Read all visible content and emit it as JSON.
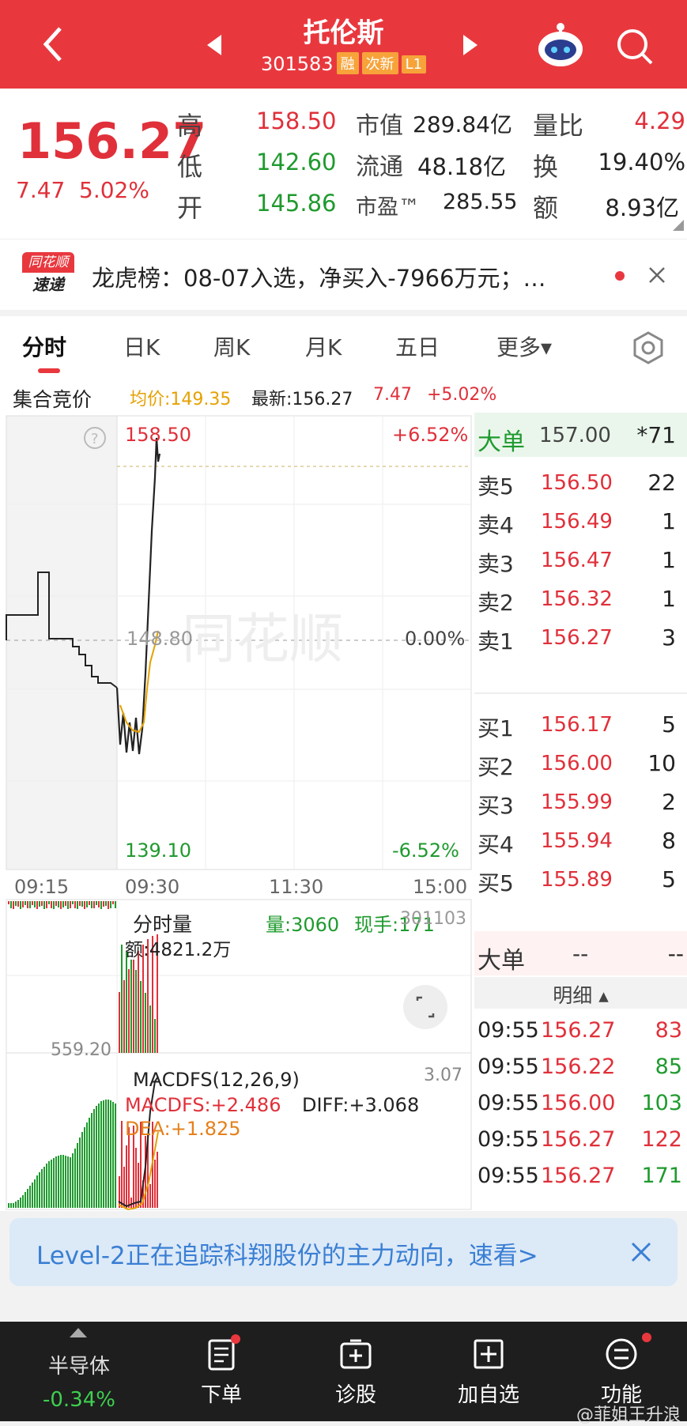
{
  "header": {
    "title": "托伦斯",
    "code": "301583",
    "tags": [
      "融",
      "次新",
      "L1"
    ]
  },
  "quote": {
    "price": "156.27",
    "change": "7.47",
    "change_pct": "5.02%",
    "rows": [
      {
        "k1": "高",
        "v1": "158.50",
        "k2": "市值",
        "v2": "289.84亿",
        "k3": "量比",
        "v3": "4.29"
      },
      {
        "k1": "低",
        "v1": "142.60",
        "k2": "流通",
        "v2": "48.18亿",
        "k3": "换",
        "v3": "19.40%"
      },
      {
        "k1": "开",
        "v1": "145.86",
        "k2": "市盈™",
        "v2": "285.55",
        "k3": "额",
        "v3": "8.93亿"
      }
    ]
  },
  "news": {
    "logo_top": "同花顺",
    "logo_bottom": "速递",
    "text": "龙虎榜：08-07入选，净买入-7966万元；…"
  },
  "tabs": [
    "分时",
    "日K",
    "周K",
    "月K",
    "五日",
    "更多▾"
  ],
  "infobar": {
    "label": "集合竞价",
    "avg": "均价:149.35",
    "latest": "最新:156.27",
    "chg": "7.47",
    "pct": "+5.02%"
  },
  "price_chart": {
    "high_label": "158.50",
    "high_pct": "+6.52%",
    "mid_label": "148.80",
    "mid_pct": "0.00%",
    "low_label": "139.10",
    "low_pct": "-6.52%",
    "times": [
      "09:15",
      "09:30",
      "11:30",
      "15:00"
    ],
    "watermark": "同花顺"
  },
  "volume_panel": {
    "title": "分时量",
    "vol": "量:3060",
    "now": "现手:171",
    "right": "301103",
    "amount": "额:4821.2万",
    "left_label": "559.20"
  },
  "macd_panel": {
    "title": "MACDFS(12,26,9)",
    "right": "3.07",
    "macd": "MACDFS:+2.486",
    "diff": "DIFF:+3.068",
    "dea": "DEA:+1.825"
  },
  "book": {
    "big_top": {
      "label": "大单",
      "price": "157.00",
      "qty": "*71"
    },
    "asks": [
      {
        "label": "卖5",
        "price": "156.50",
        "qty": "22"
      },
      {
        "label": "卖4",
        "price": "156.49",
        "qty": "1"
      },
      {
        "label": "卖3",
        "price": "156.47",
        "qty": "1"
      },
      {
        "label": "卖2",
        "price": "156.32",
        "qty": "1"
      },
      {
        "label": "卖1",
        "price": "156.27",
        "qty": "3"
      }
    ],
    "bids": [
      {
        "label": "买1",
        "price": "156.17",
        "qty": "5"
      },
      {
        "label": "买2",
        "price": "156.00",
        "qty": "10"
      },
      {
        "label": "买3",
        "price": "155.99",
        "qty": "2"
      },
      {
        "label": "买4",
        "price": "155.94",
        "qty": "8"
      },
      {
        "label": "买5",
        "price": "155.89",
        "qty": "5"
      }
    ],
    "big2": {
      "label": "大单",
      "v1": "--",
      "v2": "--"
    },
    "detail_title": "明细 ▴",
    "trades": [
      {
        "time": "09:55",
        "price": "156.27",
        "qty": "83",
        "color": "#e0303a"
      },
      {
        "time": "09:55",
        "price": "156.22",
        "qty": "85",
        "color": "#1f9a2e"
      },
      {
        "time": "09:55",
        "price": "156.00",
        "qty": "103",
        "color": "#1f9a2e"
      },
      {
        "time": "09:55",
        "price": "156.27",
        "qty": "122",
        "color": "#e0303a"
      },
      {
        "time": "09:55",
        "price": "156.27",
        "qty": "171",
        "color": "#1f9a2e"
      }
    ]
  },
  "banner": {
    "text": "Level-2正在追踪科翔股份的主力动向，速看>"
  },
  "bottom_nav": {
    "sector": "半导体",
    "sector_pct": "-0.34%",
    "items": [
      "下单",
      "诊股",
      "加自选",
      "功能"
    ]
  },
  "watermark": "@菲姐王升浪"
}
